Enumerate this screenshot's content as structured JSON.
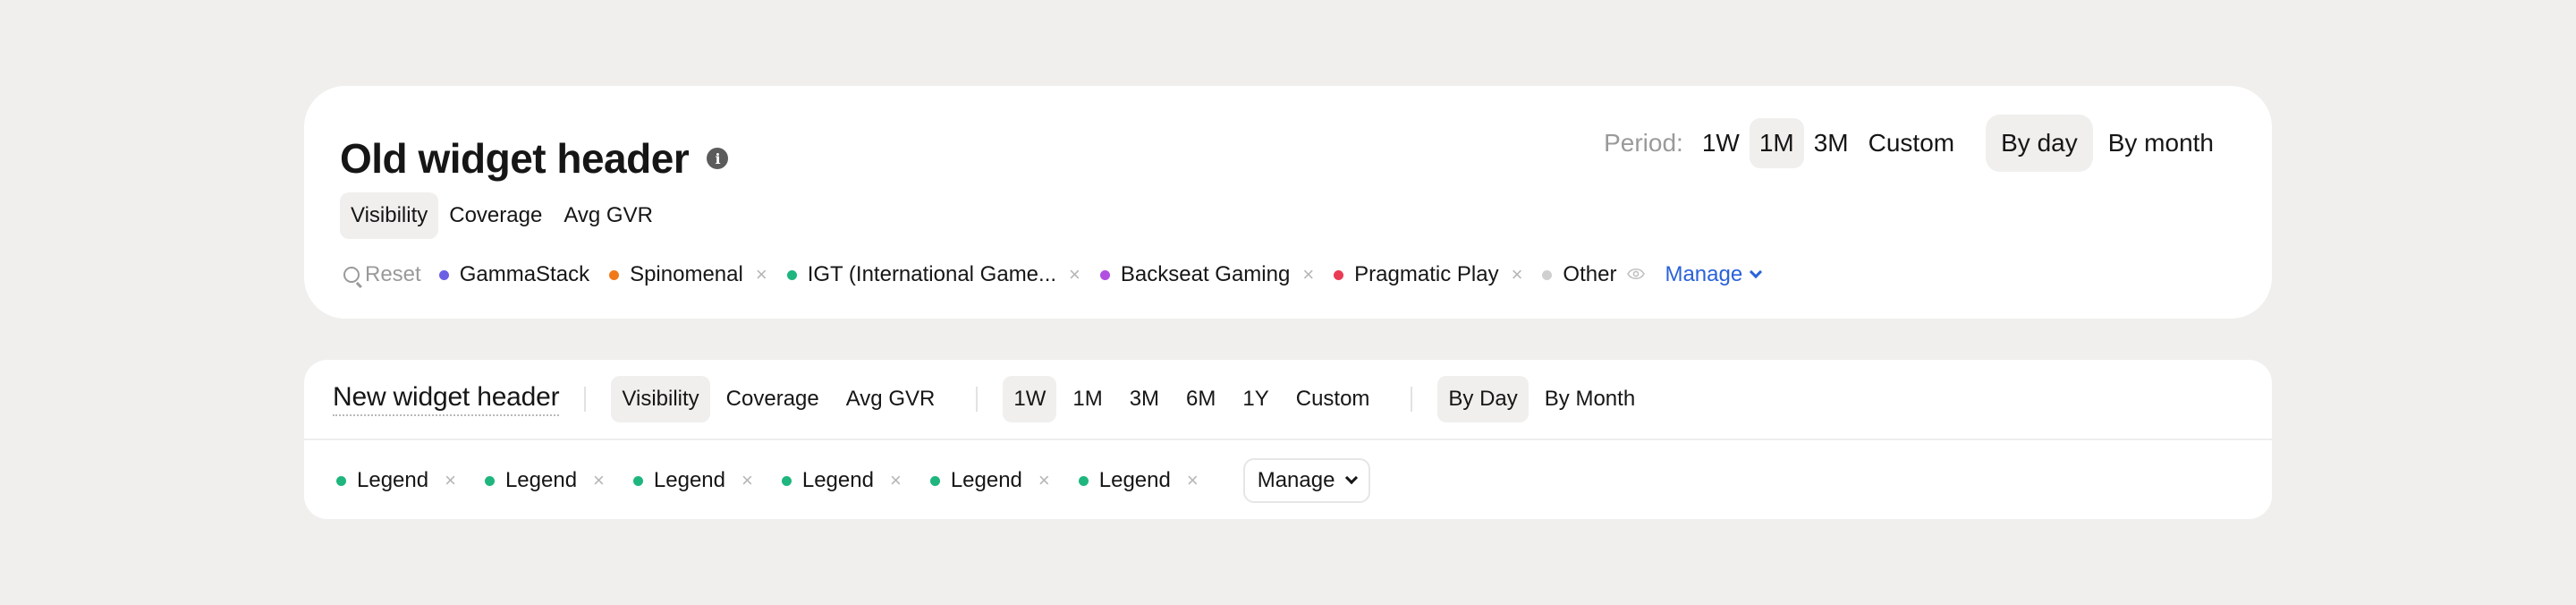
{
  "old_widget": {
    "title": "Old widget header",
    "info_icon": "i",
    "period": {
      "label": "Period:",
      "options": [
        "1W",
        "1M",
        "3M",
        "Custom"
      ],
      "active": "1M"
    },
    "granularity": {
      "options": [
        "By day",
        "By month"
      ],
      "active": "By day"
    },
    "tabs": [
      "Visibility",
      "Coverage",
      "Avg GVR"
    ],
    "active_tab": "Visibility",
    "reset_label": "Reset",
    "legend": [
      {
        "label": "GammaStack",
        "color": "#6b5fe4",
        "removable": false
      },
      {
        "label": "Spinomenal",
        "color": "#f07a1a",
        "removable": true
      },
      {
        "label": "IGT (International Game...",
        "color": "#1fb57e",
        "removable": true
      },
      {
        "label": "Backseat Gaming",
        "color": "#b14fe0",
        "removable": true
      },
      {
        "label": "Pragmatic Play",
        "color": "#ea3b55",
        "removable": true
      },
      {
        "label": "Other",
        "color": "#cfcfcf",
        "removable": false,
        "icon": "eye-icon"
      }
    ],
    "remove_glyph": "×",
    "manage_label": "Manage"
  },
  "new_widget": {
    "title": "New widget header",
    "tabs": [
      "Visibility",
      "Coverage",
      "Avg GVR"
    ],
    "active_tab": "Visibility",
    "period": {
      "options": [
        "1W",
        "1M",
        "3M",
        "6M",
        "1Y",
        "Custom"
      ],
      "active": "1W"
    },
    "granularity": {
      "options": [
        "By Day",
        "By Month"
      ],
      "active": "By Day"
    },
    "legend": [
      {
        "label": "Legend",
        "color": "#1fb57e"
      },
      {
        "label": "Legend",
        "color": "#1fb57e"
      },
      {
        "label": "Legend",
        "color": "#1fb57e"
      },
      {
        "label": "Legend",
        "color": "#1fb57e"
      },
      {
        "label": "Legend",
        "color": "#1fb57e"
      },
      {
        "label": "Legend",
        "color": "#1fb57e"
      }
    ],
    "remove_glyph": "×",
    "manage_label": "Manage"
  },
  "colors": {
    "background": "#f0efed",
    "card": "#ffffff",
    "link": "#2962d9",
    "muted": "#9a9a9a"
  }
}
